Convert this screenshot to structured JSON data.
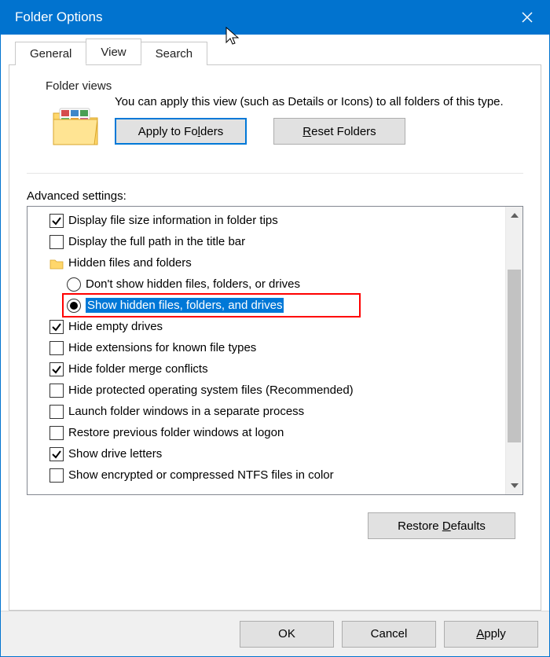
{
  "title": "Folder Options",
  "tabs": {
    "general": "General",
    "view": "View",
    "search": "Search"
  },
  "active_tab": "View",
  "folder_views": {
    "label": "Folder views",
    "desc": "You can apply this view (such as Details or Icons) to all folders of this type.",
    "apply_label": "Apply to Folders",
    "apply_mnemonic": "L",
    "reset_label": "Reset Folders",
    "reset_mnemonic": "R"
  },
  "advanced": {
    "label": "Advanced settings:",
    "items": [
      {
        "kind": "checkbox",
        "indent": 1,
        "checked": true,
        "label": "Display file size information in folder tips"
      },
      {
        "kind": "checkbox",
        "indent": 1,
        "checked": false,
        "label": "Display the full path in the title bar"
      },
      {
        "kind": "folder",
        "indent": 1,
        "label": "Hidden files and folders"
      },
      {
        "kind": "radio",
        "indent": 2,
        "checked": false,
        "label": "Don't show hidden files, folders, or drives"
      },
      {
        "kind": "radio",
        "indent": 2,
        "checked": true,
        "label": "Show hidden files, folders, and drives",
        "selected": true
      },
      {
        "kind": "checkbox",
        "indent": 1,
        "checked": true,
        "label": "Hide empty drives"
      },
      {
        "kind": "checkbox",
        "indent": 1,
        "checked": false,
        "label": "Hide extensions for known file types"
      },
      {
        "kind": "checkbox",
        "indent": 1,
        "checked": true,
        "label": "Hide folder merge conflicts"
      },
      {
        "kind": "checkbox",
        "indent": 1,
        "checked": false,
        "label": "Hide protected operating system files (Recommended)"
      },
      {
        "kind": "checkbox",
        "indent": 1,
        "checked": false,
        "label": "Launch folder windows in a separate process"
      },
      {
        "kind": "checkbox",
        "indent": 1,
        "checked": false,
        "label": "Restore previous folder windows at logon"
      },
      {
        "kind": "checkbox",
        "indent": 1,
        "checked": true,
        "label": "Show drive letters"
      },
      {
        "kind": "checkbox",
        "indent": 1,
        "checked": false,
        "label": "Show encrypted or compressed NTFS files in color"
      }
    ],
    "highlighted_index": 4,
    "restore_defaults": "Restore Defaults",
    "restore_mnemonic": "D"
  },
  "footer": {
    "ok": "OK",
    "cancel": "Cancel",
    "apply": "Apply",
    "apply_mnemonic": "A"
  }
}
